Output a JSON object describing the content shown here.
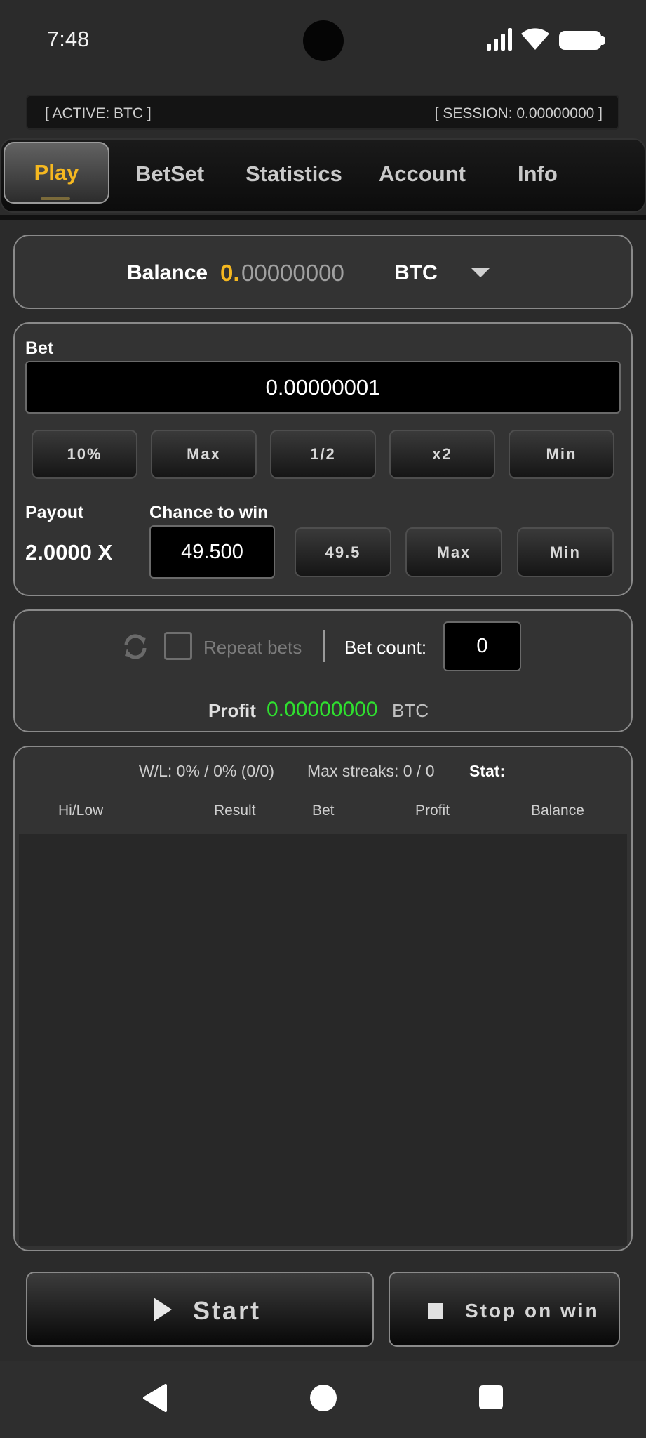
{
  "status_bar": {
    "time": "7:48"
  },
  "info_bar": {
    "active": "[ ACTIVE: BTC ]",
    "session": "[ SESSION: 0.00000000 ]"
  },
  "tabs": [
    {
      "label": "Play",
      "selected": true
    },
    {
      "label": "BetSet",
      "selected": false
    },
    {
      "label": "Statistics",
      "selected": false
    },
    {
      "label": "Account",
      "selected": false
    },
    {
      "label": "Info",
      "selected": false
    }
  ],
  "balance": {
    "label": "Balance",
    "value_prefix": "0.",
    "value_rest": "00000000",
    "currency": "BTC"
  },
  "bet": {
    "label": "Bet",
    "value": "0.00000001",
    "buttons": [
      "10%",
      "Max",
      "1/2",
      "x2",
      "Min"
    ]
  },
  "payout": {
    "label": "Payout",
    "value": "2.0000",
    "suffix": "X"
  },
  "chance": {
    "label": "Chance to win",
    "value": "49.500",
    "buttons": [
      "49.5",
      "Max",
      "Min"
    ]
  },
  "repeat": {
    "checkbox_label": "Repeat bets",
    "checked": false,
    "count_label": "Bet count:",
    "count_value": "0"
  },
  "profit": {
    "label": "Profit",
    "value": "0.00000000",
    "currency": "BTC"
  },
  "history": {
    "wl": "W/L: 0% / 0% (0/0)",
    "streaks": "Max streaks: 0 / 0",
    "stat": "Stat:",
    "columns": [
      "Hi/Low",
      "Result",
      "Bet",
      "Profit",
      "Balance"
    ]
  },
  "actions": {
    "start": "Start",
    "stop_on_win": "Stop on win"
  },
  "colors": {
    "accent": "#f5b820",
    "profit": "#2fe02f",
    "panel": "#333333",
    "background": "#2b2b2b"
  }
}
